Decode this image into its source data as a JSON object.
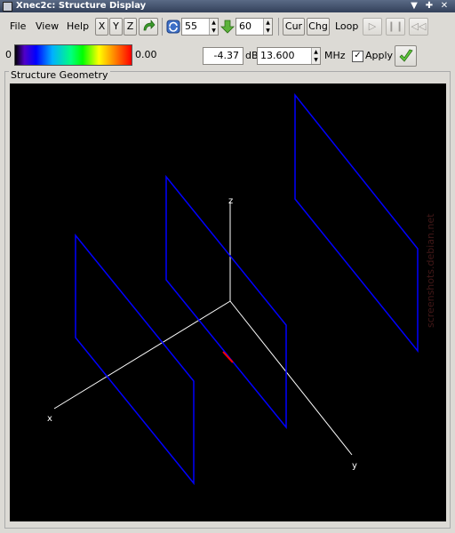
{
  "window": {
    "title": "Xnec2c: Structure Display"
  },
  "menu": {
    "file": "File",
    "view": "View",
    "help": "Help"
  },
  "toolbar": {
    "x": "X",
    "y": "Y",
    "z": "Z",
    "rot_value": "55",
    "incl_value": "60",
    "cur": "Cur",
    "chg": "Chg",
    "loop": "Loop"
  },
  "scale": {
    "min": "0",
    "max": "0.00"
  },
  "gain": {
    "value": "-4.37",
    "unit": "dB"
  },
  "frequency": {
    "value": "13.600",
    "unit": "MHz"
  },
  "apply": {
    "label": "Apply",
    "checked": true
  },
  "panel": {
    "title": "Structure Geometry"
  },
  "axes": {
    "x": "x",
    "y": "y",
    "z": "z"
  },
  "colors": {
    "structure": "#0000ff",
    "excitation": "#ff0000",
    "axis": "#ffffff",
    "background": "#000000"
  },
  "watermark": "screenshots.debian.net"
}
